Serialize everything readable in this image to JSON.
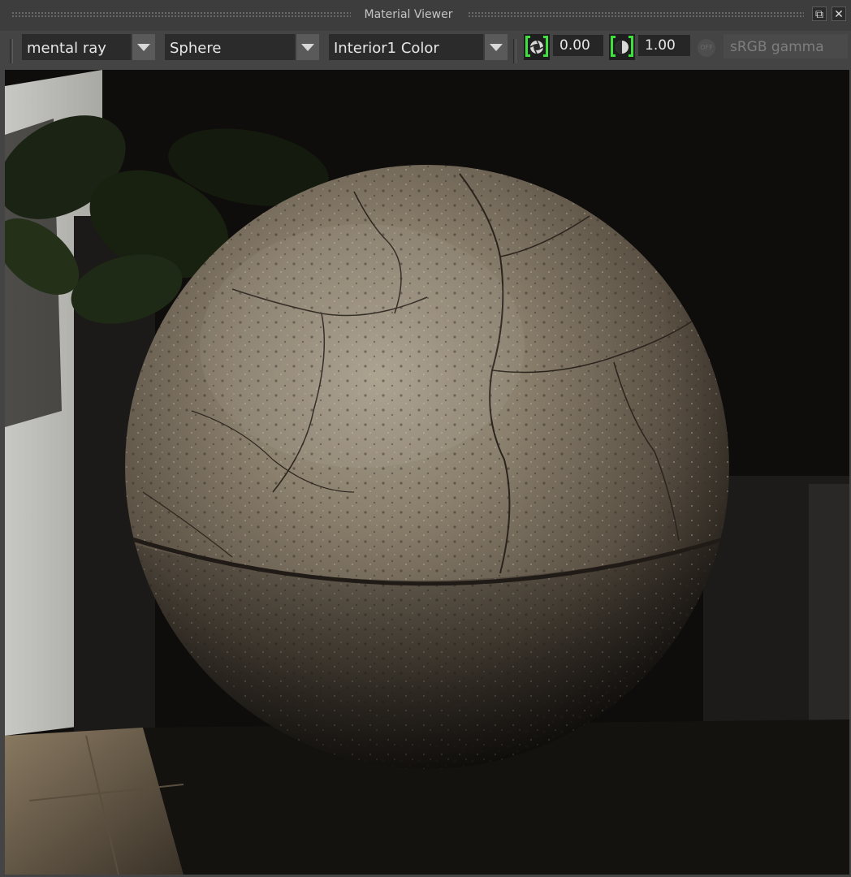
{
  "window": {
    "title": "Material Viewer",
    "float_icon": "float-window-icon",
    "close_icon": "close-icon"
  },
  "toolbar": {
    "renderer": "mental ray",
    "shape": "Sphere",
    "material": "Interior1 Color",
    "exposure_icon": "exposure-icon",
    "exposure_value": "0.00",
    "gamma_icon": "gamma-icon",
    "gamma_value": "1.00",
    "view_transform_toggle": "OFF",
    "color_space": "sRGB gamma"
  },
  "viewport": {
    "content": "material-preview-render",
    "colors": {
      "background": "#0c0c0b",
      "sphere_highlight": "#a89e8c",
      "sphere_shadow": "#1c1814",
      "toggle_accent": "#3ee03e"
    }
  }
}
